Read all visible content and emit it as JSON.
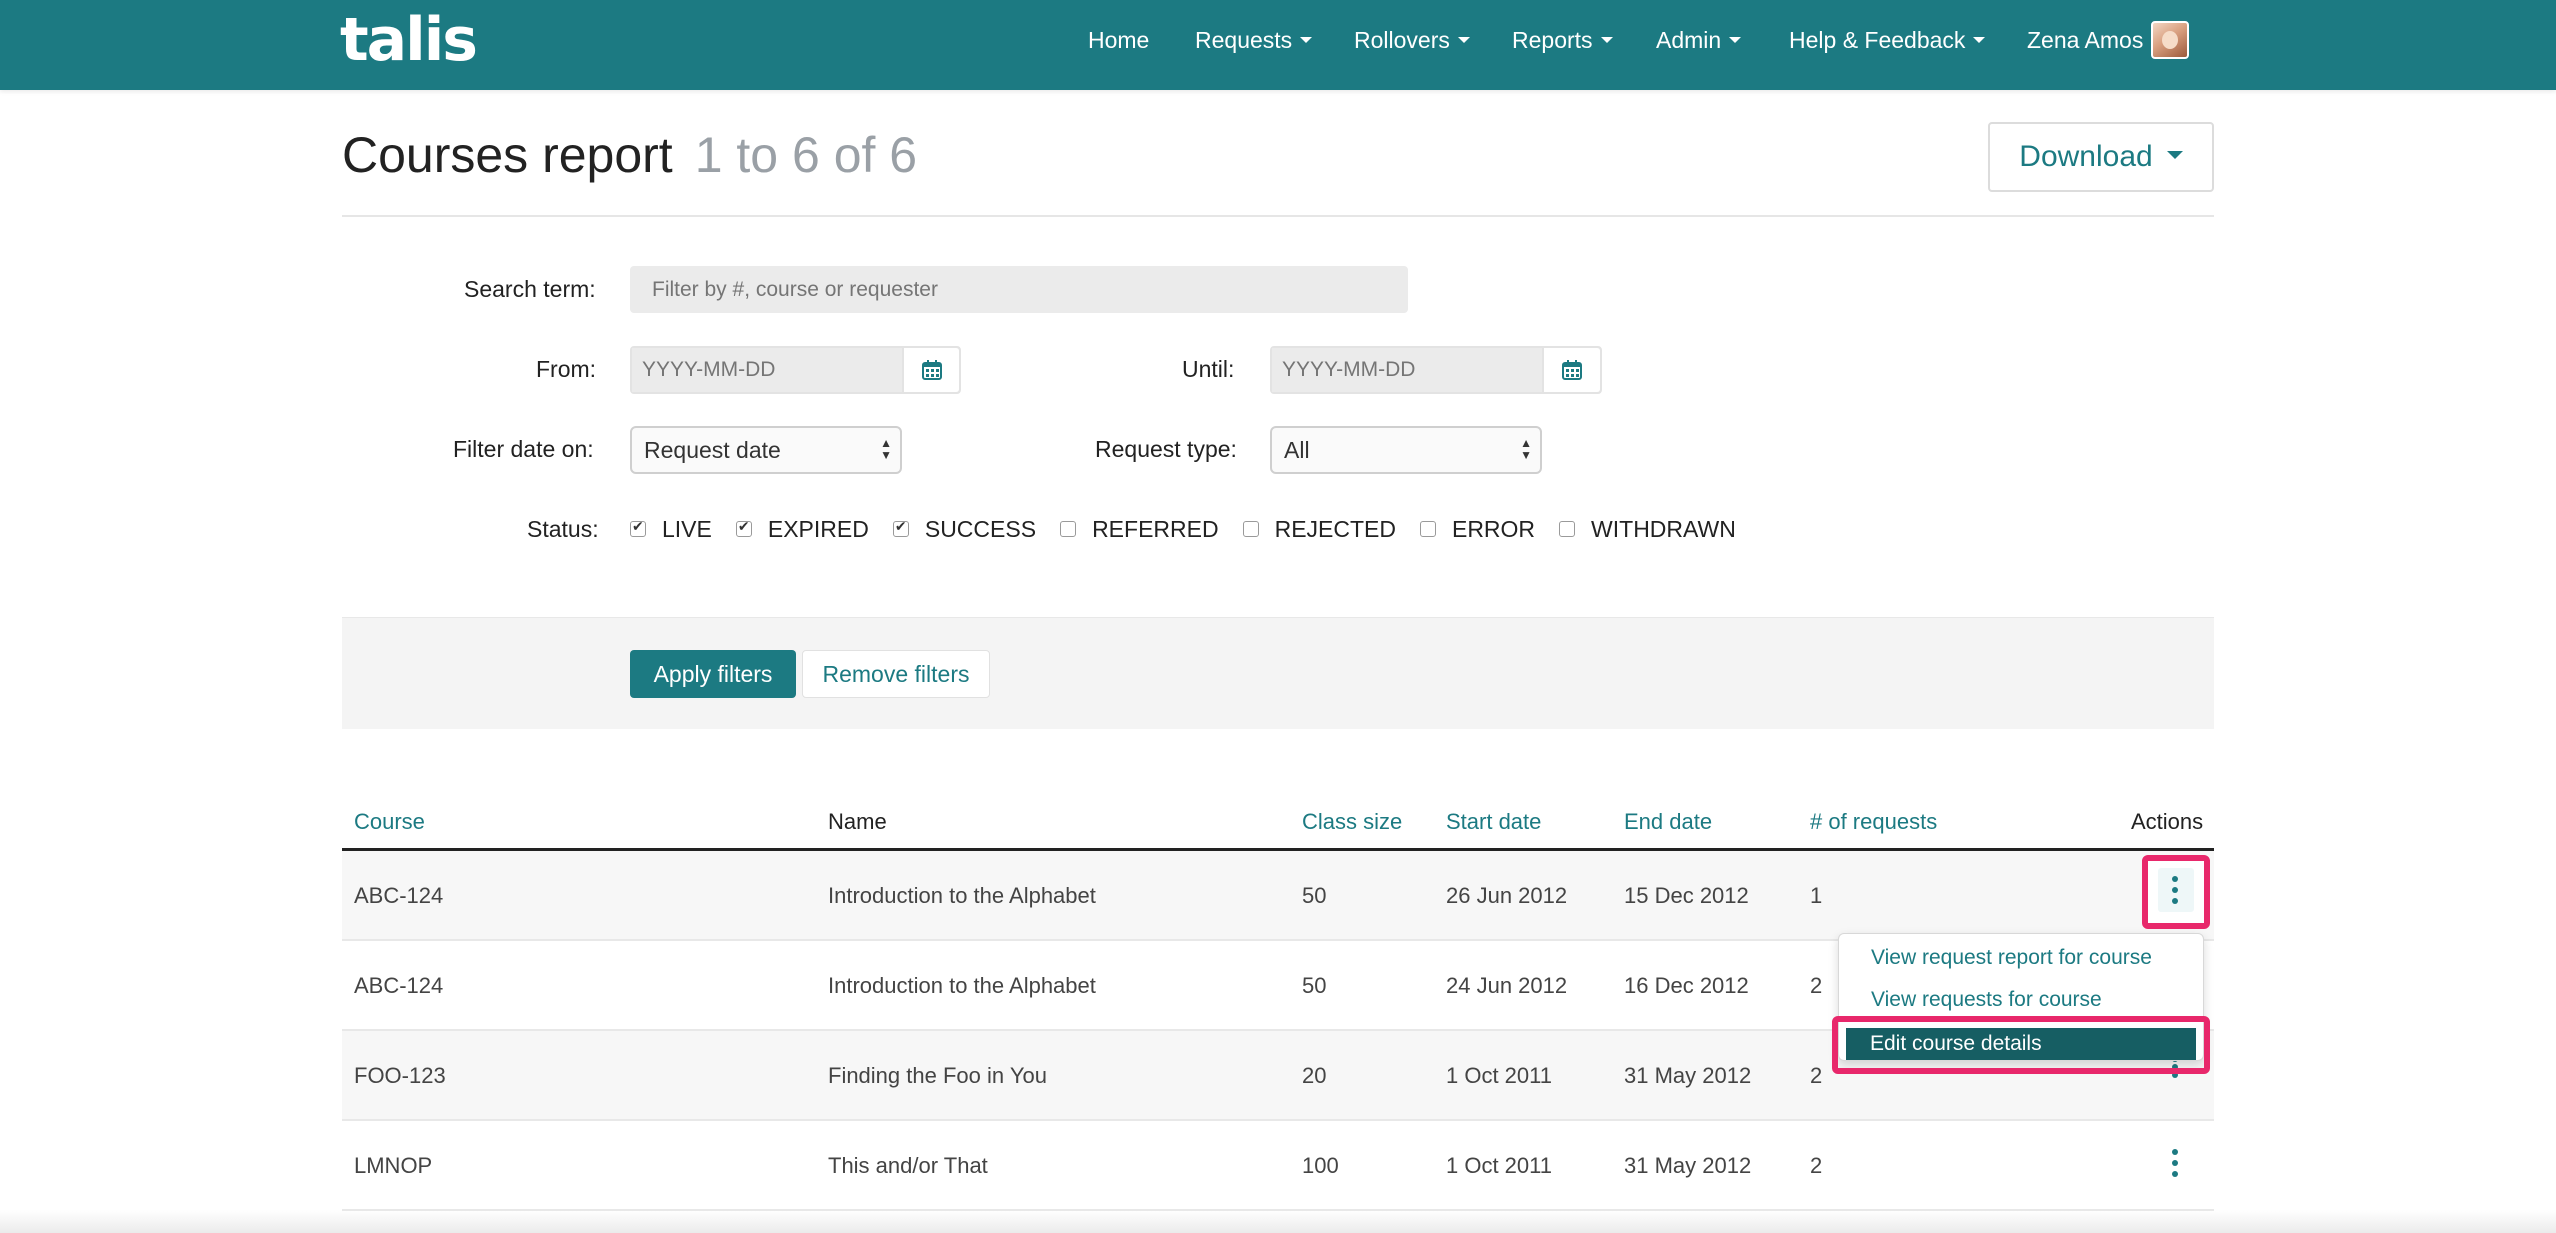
{
  "nav": {
    "logo": "talis",
    "links": {
      "home": "Home",
      "requests": "Requests",
      "rollovers": "Rollovers",
      "reports": "Reports",
      "admin": "Admin",
      "help": "Help & Feedback"
    },
    "user_name": "Zena Amos"
  },
  "header": {
    "title": "Courses report",
    "count": "1 to 6 of 6",
    "download_label": "Download"
  },
  "filters": {
    "search_label": "Search term:",
    "search_placeholder": "Filter by #, course or requester",
    "from_label": "From:",
    "from_placeholder": "YYYY-MM-DD",
    "until_label": "Until:",
    "until_placeholder": "YYYY-MM-DD",
    "filter_date_label": "Filter date on:",
    "filter_date_value": "Request date",
    "request_type_label": "Request type:",
    "request_type_value": "All",
    "status_label": "Status:",
    "statuses": [
      {
        "label": "LIVE",
        "checked": true
      },
      {
        "label": "EXPIRED",
        "checked": true
      },
      {
        "label": "SUCCESS",
        "checked": true
      },
      {
        "label": "REFERRED",
        "checked": false
      },
      {
        "label": "REJECTED",
        "checked": false
      },
      {
        "label": "ERROR",
        "checked": false
      },
      {
        "label": "WITHDRAWN",
        "checked": false
      }
    ],
    "apply_label": "Apply filters",
    "remove_label": "Remove filters"
  },
  "table": {
    "headers": {
      "course": "Course",
      "name": "Name",
      "class_size": "Class size",
      "start_date": "Start date",
      "end_date": "End date",
      "requests": "# of requests",
      "actions": "Actions"
    },
    "rows": [
      {
        "course": "ABC-124",
        "name": "Introduction to the Alphabet",
        "class_size": "50",
        "start_date": "26 Jun 2012",
        "end_date": "15 Dec 2012",
        "requests": "1"
      },
      {
        "course": "ABC-124",
        "name": "Introduction to the Alphabet",
        "class_size": "50",
        "start_date": "24 Jun 2012",
        "end_date": "16 Dec 2012",
        "requests": "2"
      },
      {
        "course": "FOO-123",
        "name": "Finding the Foo in You",
        "class_size": "20",
        "start_date": "1 Oct 2011",
        "end_date": "31 May 2012",
        "requests": "2"
      },
      {
        "course": "LMNOP",
        "name": "This and/or That",
        "class_size": "100",
        "start_date": "1 Oct 2011",
        "end_date": "31 May 2012",
        "requests": "2"
      }
    ]
  },
  "actions_menu": {
    "items": [
      "View request report for course",
      "View requests for course",
      "Edit course details"
    ]
  },
  "colors": {
    "brand": "#1c7a82",
    "highlight": "#e8286b",
    "menu_active": "#165e63"
  }
}
